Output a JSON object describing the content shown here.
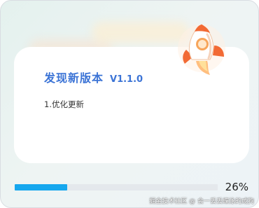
{
  "dialog": {
    "title": "发现新版本",
    "version": "V1.1.0",
    "release_notes": "1.优化更新",
    "illustration_icon": "rocket-icon"
  },
  "progress": {
    "percent": 26,
    "label": "26%"
  },
  "watermark": "掘金技术社区 @ 会一丢丢蝶泳的咸狗",
  "colors": {
    "accent": "#3c74d6",
    "progress_fill": "#16a7ee",
    "progress_track": "#e4e8ec",
    "background": "#eaf3f1"
  }
}
